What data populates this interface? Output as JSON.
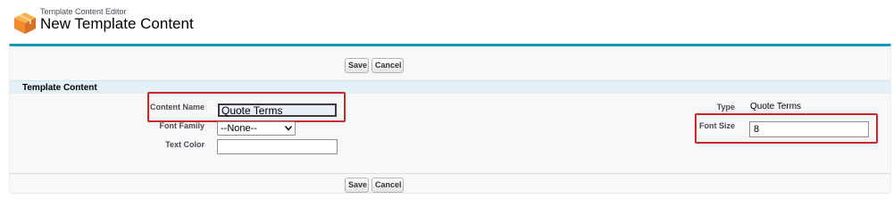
{
  "header": {
    "breadcrumb": "Template Content Editor",
    "title": "New Template Content",
    "icon": "cube-icon"
  },
  "buttons": {
    "save_label": "Save",
    "cancel_label": "Cancel"
  },
  "section": {
    "title": "Template Content"
  },
  "fields": {
    "content_name": {
      "label": "Content Name",
      "value": "Quote Terms"
    },
    "font_family": {
      "label": "Font Family",
      "value": "--None--"
    },
    "text_color": {
      "label": "Text Color",
      "value": ""
    },
    "type": {
      "label": "Type",
      "value": "Quote Terms"
    },
    "font_size": {
      "label": "Font Size",
      "value": "8"
    }
  },
  "colors": {
    "accent": "#1797c0",
    "section_bg": "#e3f0f8",
    "highlight": "#c62a2a",
    "icon_orange": "#f39c3c"
  }
}
